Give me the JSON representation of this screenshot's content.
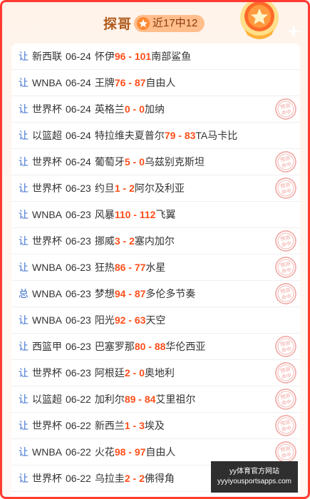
{
  "header": {
    "title": "探哥",
    "badge": "近17中12",
    "stamp_text": "预测命中"
  },
  "rows": [
    {
      "type": "让",
      "league": "新西联",
      "date": "06-24",
      "home": "怀伊",
      "home_score": "96",
      "away_score": "101",
      "away": "南部鲨鱼",
      "hit": false
    },
    {
      "type": "让",
      "league": "WNBA",
      "date": "06-24",
      "home": "王牌",
      "home_score": "76",
      "away_score": "87",
      "away": "自由人",
      "hit": false
    },
    {
      "type": "让",
      "league": "世界杯",
      "date": "06-24",
      "home": "英格兰",
      "home_score": "0",
      "away_score": "0",
      "away": "加纳",
      "hit": true
    },
    {
      "type": "让",
      "league": "以篮超",
      "date": "06-24",
      "home": "特拉维夫夏普尔",
      "home_score": "79",
      "away_score": "83",
      "away": "TA马卡比",
      "hit": false
    },
    {
      "type": "让",
      "league": "世界杯",
      "date": "06-24",
      "home": "葡萄牙",
      "home_score": "5",
      "away_score": "0",
      "away": "乌兹别克斯坦",
      "hit": true
    },
    {
      "type": "让",
      "league": "世界杯",
      "date": "06-23",
      "home": "约旦",
      "home_score": "1",
      "away_score": "2",
      "away": "阿尔及利亚",
      "hit": true
    },
    {
      "type": "让",
      "league": "WNBA",
      "date": "06-23",
      "home": "风暴",
      "home_score": "110",
      "away_score": "112",
      "away": "飞翼",
      "hit": false
    },
    {
      "type": "让",
      "league": "世界杯",
      "date": "06-23",
      "home": "挪威",
      "home_score": "3",
      "away_score": "2",
      "away": "塞内加尔",
      "hit": true
    },
    {
      "type": "让",
      "league": "WNBA",
      "date": "06-23",
      "home": "狂热",
      "home_score": "86",
      "away_score": "77",
      "away": "水星",
      "hit": true
    },
    {
      "type": "总",
      "league": "WNBA",
      "date": "06-23",
      "home": "梦想",
      "home_score": "94",
      "away_score": "87",
      "away": "多伦多节奏",
      "hit": true
    },
    {
      "type": "让",
      "league": "WNBA",
      "date": "06-23",
      "home": "阳光",
      "home_score": "92",
      "away_score": "63",
      "away": "天空",
      "hit": false
    },
    {
      "type": "让",
      "league": "西篮甲",
      "date": "06-23",
      "home": "巴塞罗那",
      "home_score": "80",
      "away_score": "88",
      "away": "华伦西亚",
      "hit": true
    },
    {
      "type": "让",
      "league": "世界杯",
      "date": "06-23",
      "home": "阿根廷",
      "home_score": "2",
      "away_score": "0",
      "away": "奥地利",
      "hit": true
    },
    {
      "type": "让",
      "league": "以篮超",
      "date": "06-22",
      "home": "加利尔",
      "home_score": "89",
      "away_score": "84",
      "away": "艾里祖尔",
      "hit": true
    },
    {
      "type": "让",
      "league": "世界杯",
      "date": "06-22",
      "home": "新西兰",
      "home_score": "1",
      "away_score": "3",
      "away": "埃及",
      "hit": true
    },
    {
      "type": "让",
      "league": "WNBA",
      "date": "06-22",
      "home": "火花",
      "home_score": "98",
      "away_score": "97",
      "away": "自由人",
      "hit": true
    },
    {
      "type": "让",
      "league": "世界杯",
      "date": "06-22",
      "home": "乌拉圭",
      "home_score": "2",
      "away_score": "2",
      "away": "佛得角",
      "hit": true
    }
  ],
  "watermark": {
    "line1": "yy体育官方网站",
    "line2": "yyyiyousportsapps.com"
  },
  "colors": {
    "border": "#ff3b30",
    "title": "#b15b1c",
    "badge_bg": "#ffbe8c",
    "type": "#3a6fd0",
    "score": "#ff4e1a",
    "stamp": "#f0a7a2"
  }
}
